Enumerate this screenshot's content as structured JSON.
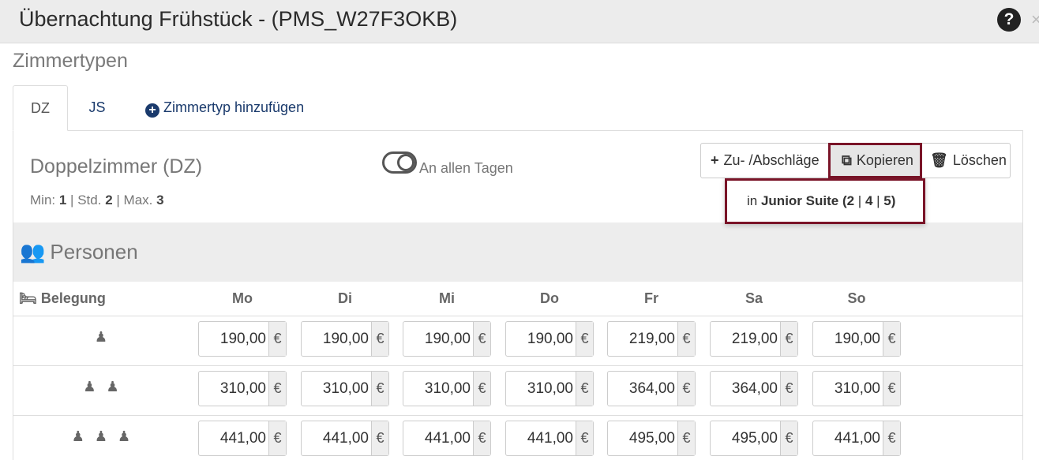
{
  "window": {
    "title": "Übernachtung Frühstück - (PMS_W27F3OKB)",
    "help_icon": "question-circle-icon",
    "close_icon": "close-icon"
  },
  "section_title": "Zimmertypen",
  "tabs": [
    {
      "label": "DZ",
      "active": true
    },
    {
      "label": "JS",
      "active": false
    },
    {
      "label": "Zimmertyp hinzufügen",
      "icon": "plus-circle-icon"
    }
  ],
  "room": {
    "name": "Doppelzimmer (DZ)",
    "min_label": "Min:",
    "min": "1",
    "std_label": "Std.",
    "std": "2",
    "max_label": "Max.",
    "max": "3",
    "toggle_label": "An allen Tagen"
  },
  "toolbar": {
    "surcharge_label": "Zu- /Abschläge",
    "copy_label": "Kopieren",
    "delete_label": "Löschen"
  },
  "copy_dropdown": {
    "prefix": "in",
    "target": "Junior Suite",
    "min": "2",
    "std": "4",
    "max": "5"
  },
  "persons": {
    "label": "Personen",
    "occupancy_label": "Belegung",
    "days": [
      "Mo",
      "Di",
      "Mi",
      "Do",
      "Fr",
      "Sa",
      "So"
    ],
    "currency": "€",
    "rows": [
      {
        "persons": 1,
        "prices": [
          "190,00",
          "190,00",
          "190,00",
          "190,00",
          "219,00",
          "219,00",
          "190,00"
        ]
      },
      {
        "persons": 2,
        "prices": [
          "310,00",
          "310,00",
          "310,00",
          "310,00",
          "364,00",
          "364,00",
          "310,00"
        ]
      },
      {
        "persons": 3,
        "prices": [
          "441,00",
          "441,00",
          "441,00",
          "441,00",
          "495,00",
          "495,00",
          "441,00"
        ]
      }
    ]
  },
  "colors": {
    "highlight": "#7a1428",
    "link": "#1a3a6c"
  }
}
